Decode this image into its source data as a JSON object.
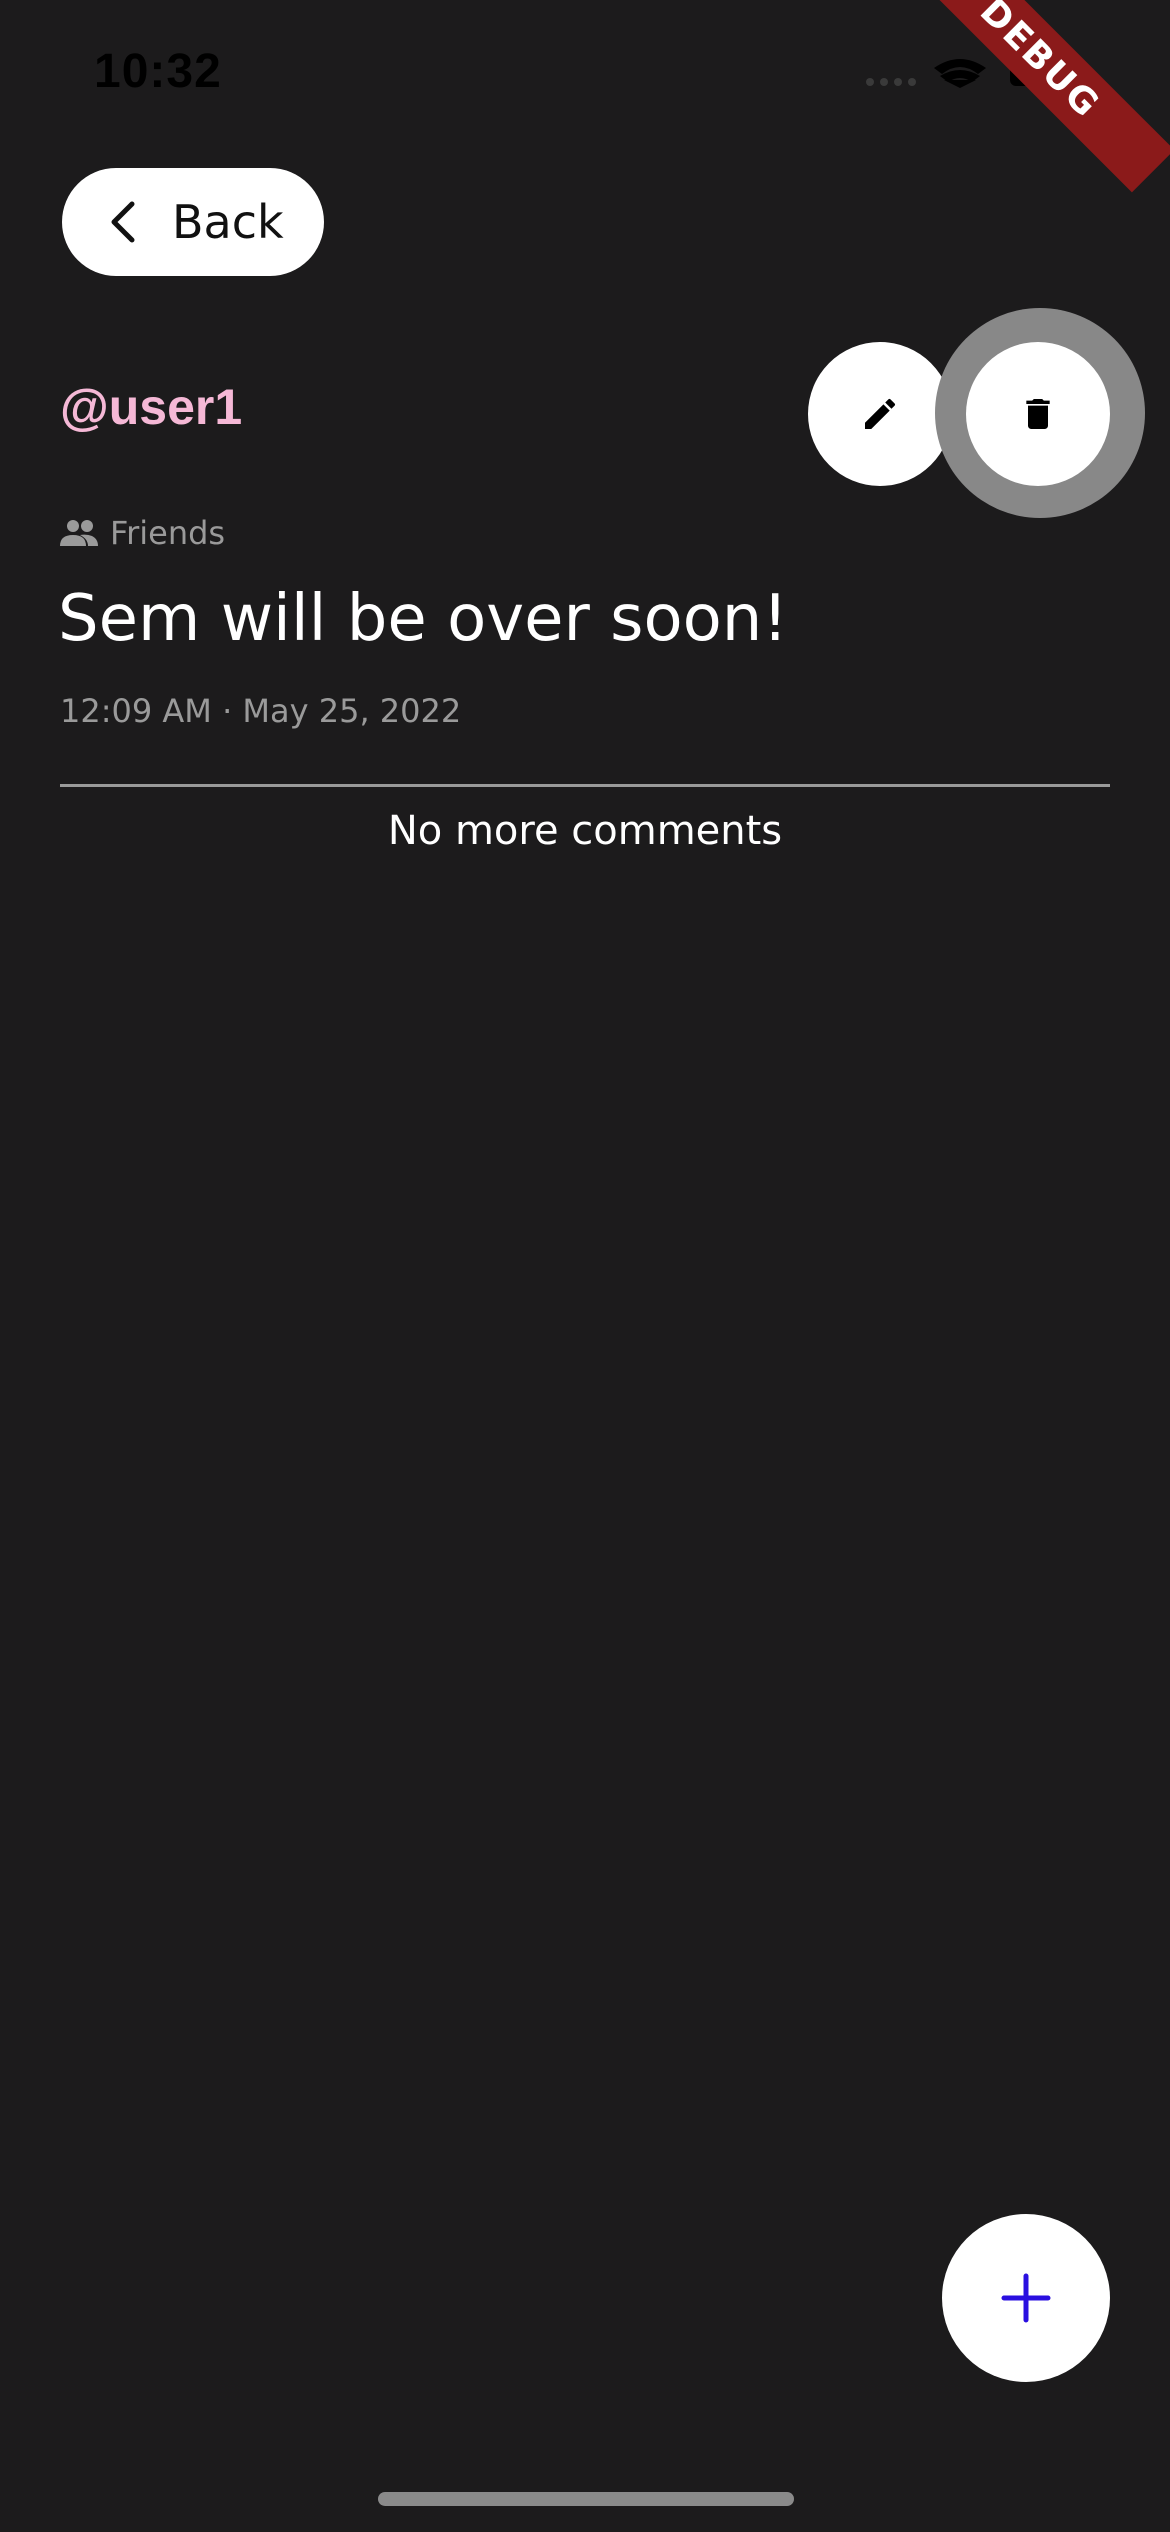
{
  "status_bar": {
    "time": "10:32",
    "icons": [
      "signal-icon",
      "wifi-icon",
      "battery-icon"
    ]
  },
  "debug_banner": "DEBUG",
  "header": {
    "back_label": "Back",
    "back_icon": "chevron-left-icon"
  },
  "post": {
    "username": "@user1",
    "audience_icon": "people-icon",
    "audience": "Friends",
    "text": "Sem will be over soon!",
    "timestamp": "12:09 AM · May 25, 2022",
    "actions": {
      "edit_icon": "pencil-icon",
      "delete_icon": "trash-icon"
    }
  },
  "comments": {
    "empty_message": "No more comments"
  },
  "fab": {
    "icon": "plus-icon"
  },
  "colors": {
    "background": "#1c1b1c",
    "username": "#f5b8d6",
    "fab_icon": "#2a0fe0",
    "secondary_text": "#9a9a9a",
    "debug": "#8b1a1a"
  }
}
